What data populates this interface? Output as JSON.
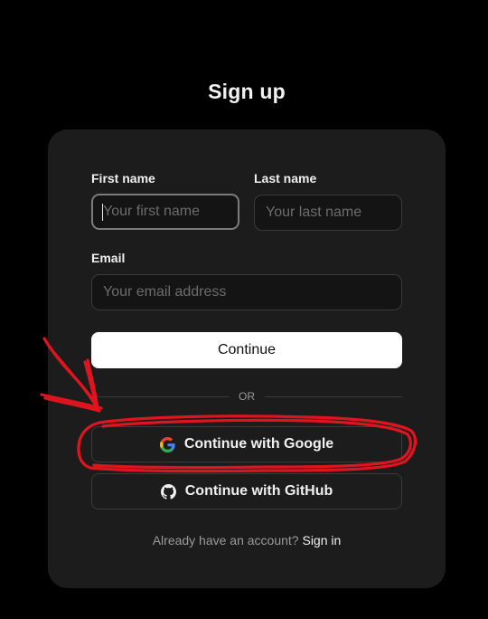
{
  "page": {
    "title": "Sign up"
  },
  "form": {
    "first_name": {
      "label": "First name",
      "placeholder": "Your first name",
      "value": ""
    },
    "last_name": {
      "label": "Last name",
      "placeholder": "Your last name",
      "value": ""
    },
    "email": {
      "label": "Email",
      "placeholder": "Your email address",
      "value": ""
    },
    "continue_label": "Continue",
    "divider_label": "OR",
    "google_label": "Continue with Google",
    "github_label": "Continue with GitHub"
  },
  "footer": {
    "prompt": "Already have an account?",
    "sign_in_label": "Sign in"
  },
  "colors": {
    "background": "#000000",
    "card": "#1c1c1c",
    "primary_button": "#ffffff",
    "annotation": "#e0141f"
  },
  "icons": {
    "google": "google-icon",
    "github": "github-icon"
  }
}
